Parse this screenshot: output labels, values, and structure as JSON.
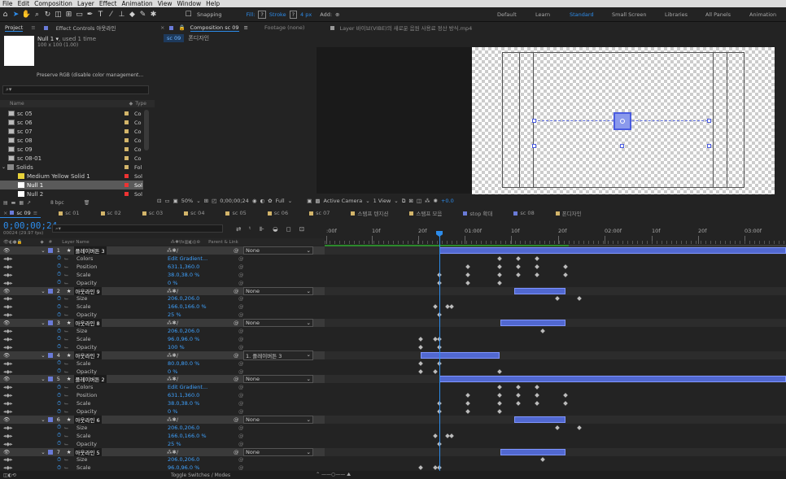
{
  "menu": [
    "File",
    "Edit",
    "Composition",
    "Layer",
    "Effect",
    "Animation",
    "View",
    "Window",
    "Help"
  ],
  "toolbar": {
    "snapping": "Snapping",
    "fill": "Fill:",
    "stroke": "Stroke",
    "stroke_px": "4 px",
    "add": "Add:"
  },
  "workspaces": [
    "Default",
    "Learn",
    "Standard",
    "Small Screen",
    "Libraries",
    "All Panels",
    "Animation"
  ],
  "project": {
    "tab": "Project",
    "effect_tab": "Effect Controls 아웃라인",
    "item_name": "Null 1",
    "item_used": ", used 1 time",
    "item_size": "100 x 100 (1.00)",
    "preserve": "Preserve RGB (disable color management...",
    "col_name": "Name",
    "col_type": "Type",
    "items": [
      {
        "name": "sc 05",
        "type": "Co"
      },
      {
        "name": "sc 06",
        "type": "Co"
      },
      {
        "name": "sc 07",
        "type": "Co"
      },
      {
        "name": "sc 08",
        "type": "Co"
      },
      {
        "name": "sc 09",
        "type": "Co"
      },
      {
        "name": "sc 08-01",
        "type": "Co"
      },
      {
        "name": "Solids",
        "type": "Fol"
      },
      {
        "name": "Medium Yellow Solid 1",
        "type": "Sol"
      },
      {
        "name": "Null 1",
        "type": "Sol"
      },
      {
        "name": "Null 2",
        "type": "Sol"
      }
    ],
    "bpc": "8 bpc"
  },
  "comp": {
    "tab": "Composition sc 09",
    "footage": "Footage (none)",
    "layer": "Layer 바이브(VIBE)의 새로운 음원 사용료 정산 방식.mp4",
    "breadcrumb1": "sc 09",
    "breadcrumb2": "폰디자인",
    "zoom": "50%",
    "time": "0;00;00;24",
    "res": "Full",
    "camera": "Active Camera",
    "view": "1 View",
    "exposure": "+0.0"
  },
  "timeline": {
    "time": "0;00;00;24",
    "frames": "00024 (29.97 fps)",
    "tabs": [
      "sc 09",
      "sc 01",
      "sc 02",
      "sc 03",
      "sc 04",
      "sc 05",
      "sc 06",
      "sc 07",
      "스탬프 텐지션",
      "스탬프 모음",
      "stop 확대",
      "sc 08",
      "폰디자인"
    ],
    "col_layer": "Layer Name",
    "col_parent": "Parent & Link",
    "toggle": "Toggle Switches / Modes",
    "ruler": [
      ":00f",
      "10f",
      "20f",
      "01:00f",
      "10f",
      "20f",
      "02:00f",
      "10f",
      "20f",
      "03:00f"
    ],
    "rows": [
      {
        "k": "layer",
        "num": "1",
        "name": "플레이버튼 3",
        "parent": "None"
      },
      {
        "k": "prop",
        "name": "Colors",
        "val": "Edit Gradient..."
      },
      {
        "k": "prop",
        "name": "Position",
        "val": "631.1,360.0"
      },
      {
        "k": "prop",
        "name": "Scale",
        "val": "38.0,38.0 %"
      },
      {
        "k": "prop",
        "name": "Opacity",
        "val": "0 %"
      },
      {
        "k": "layer",
        "num": "2",
        "name": "아웃라인 9",
        "parent": "None"
      },
      {
        "k": "prop",
        "name": "Size",
        "val": "206.0,206.0"
      },
      {
        "k": "prop",
        "name": "Scale",
        "val": "166.0,166.0 %"
      },
      {
        "k": "prop",
        "name": "Opacity",
        "val": "25 %"
      },
      {
        "k": "layer",
        "num": "3",
        "name": "아웃라인 8",
        "parent": "None"
      },
      {
        "k": "prop",
        "name": "Size",
        "val": "206.0,206.0"
      },
      {
        "k": "prop",
        "name": "Scale",
        "val": "96.0,96.0 %"
      },
      {
        "k": "prop",
        "name": "Opacity",
        "val": "100 %"
      },
      {
        "k": "layer",
        "num": "4",
        "name": "아웃라인 7",
        "parent": "1. 플레이버튼 3"
      },
      {
        "k": "prop",
        "name": "Scale",
        "val": "80.0,80.0 %"
      },
      {
        "k": "prop",
        "name": "Opacity",
        "val": "0 %"
      },
      {
        "k": "layer",
        "num": "5",
        "name": "플레이버튼 2",
        "parent": "None"
      },
      {
        "k": "prop",
        "name": "Colors",
        "val": "Edit Gradient..."
      },
      {
        "k": "prop",
        "name": "Position",
        "val": "631.1,360.0"
      },
      {
        "k": "prop",
        "name": "Scale",
        "val": "38.0,38.0 %"
      },
      {
        "k": "prop",
        "name": "Opacity",
        "val": "0 %"
      },
      {
        "k": "layer",
        "num": "6",
        "name": "아웃라인 6",
        "parent": "None"
      },
      {
        "k": "prop",
        "name": "Size",
        "val": "206.0,206.0"
      },
      {
        "k": "prop",
        "name": "Scale",
        "val": "166.0,166.0 %"
      },
      {
        "k": "prop",
        "name": "Opacity",
        "val": "25 %"
      },
      {
        "k": "layer",
        "num": "7",
        "name": "아웃라인 5",
        "parent": "None"
      },
      {
        "k": "prop",
        "name": "Size",
        "val": "206.0,206.0"
      },
      {
        "k": "prop",
        "name": "Scale",
        "val": "96.0,96.0 %"
      }
    ]
  }
}
